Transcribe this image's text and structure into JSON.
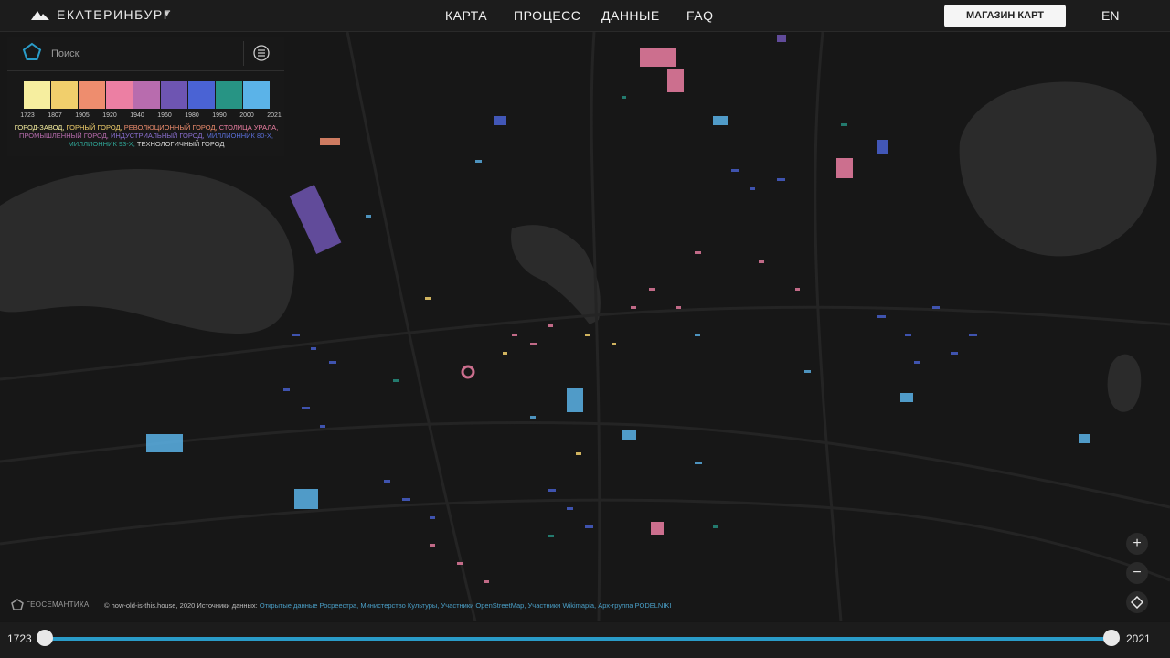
{
  "header": {
    "city": "ЕКАТЕРИНБУРГ",
    "nav": [
      "КАРТА",
      "ПРОЦЕСС",
      "ДАННЫЕ",
      "FAQ"
    ],
    "shop_label": "МАГАЗИН КАРТ",
    "lang_label": "EN",
    "icons": {
      "logo": "mountain-logo-icon",
      "city_dropdown": "caret-down-icon"
    }
  },
  "search": {
    "placeholder": "Поиск",
    "icons": {
      "search": "pentagon-search-icon",
      "list": "list-menu-icon"
    }
  },
  "legend": {
    "colors": [
      "#f6ee9f",
      "#f1cf6c",
      "#ee8d6e",
      "#ec7fa3",
      "#b86cae",
      "#6e55b2",
      "#4a63d4",
      "#279484",
      "#5bb3e8"
    ],
    "years": [
      "1723",
      "1807",
      "1905",
      "1920",
      "1940",
      "1960",
      "1980",
      "1990",
      "2000",
      "2021"
    ],
    "eras": [
      {
        "label": "ГОРОД-ЗАВОД,",
        "color": "#f6ee9f"
      },
      {
        "label": "ГОРНЫЙ ГОРОД,",
        "color": "#f1cf6c"
      },
      {
        "label": "РЕВОЛЮЦИОННЫЙ ГОРОД,",
        "color": "#ee8d6e"
      },
      {
        "label": "СТОЛИЦА УРАЛА,",
        "color": "#ec7fa3"
      },
      {
        "label": "ПРОМЫШЛЕННЫЙ ГОРОД,",
        "color": "#b86cae"
      },
      {
        "label": "ИНДУСТРИАЛЬНЫЙ ГОРОД,",
        "color": "#8a6fd0"
      },
      {
        "label": "МИЛЛИОННИК 80-Х,",
        "color": "#5b6fd8"
      },
      {
        "label": "МИЛЛИОННИК 93-Х,",
        "color": "#2fa596"
      },
      {
        "label": "ТЕХНОЛОГИЧНЫЙ ГОРОД",
        "color": "#d8d8d8"
      }
    ]
  },
  "attribution": {
    "brand": "ГЕОСЕМАНТИКА",
    "prefix": "© how-old-is-this.house, 2020 Источники данных:",
    "sources": [
      "Открытые данные Росреестра,",
      "Министерство Культуры,",
      "Участники OpenStreetMap,",
      "Участники Wikimapia,",
      "Арх-группа PODELNIKI"
    ]
  },
  "map_controls": {
    "zoom_in": "+",
    "zoom_out": "−",
    "icons": {
      "locate": "diamond-locate-icon"
    }
  },
  "timeline": {
    "start_label": "1723",
    "end_label": "2021",
    "selected_range": [
      "1723",
      "2021"
    ]
  }
}
